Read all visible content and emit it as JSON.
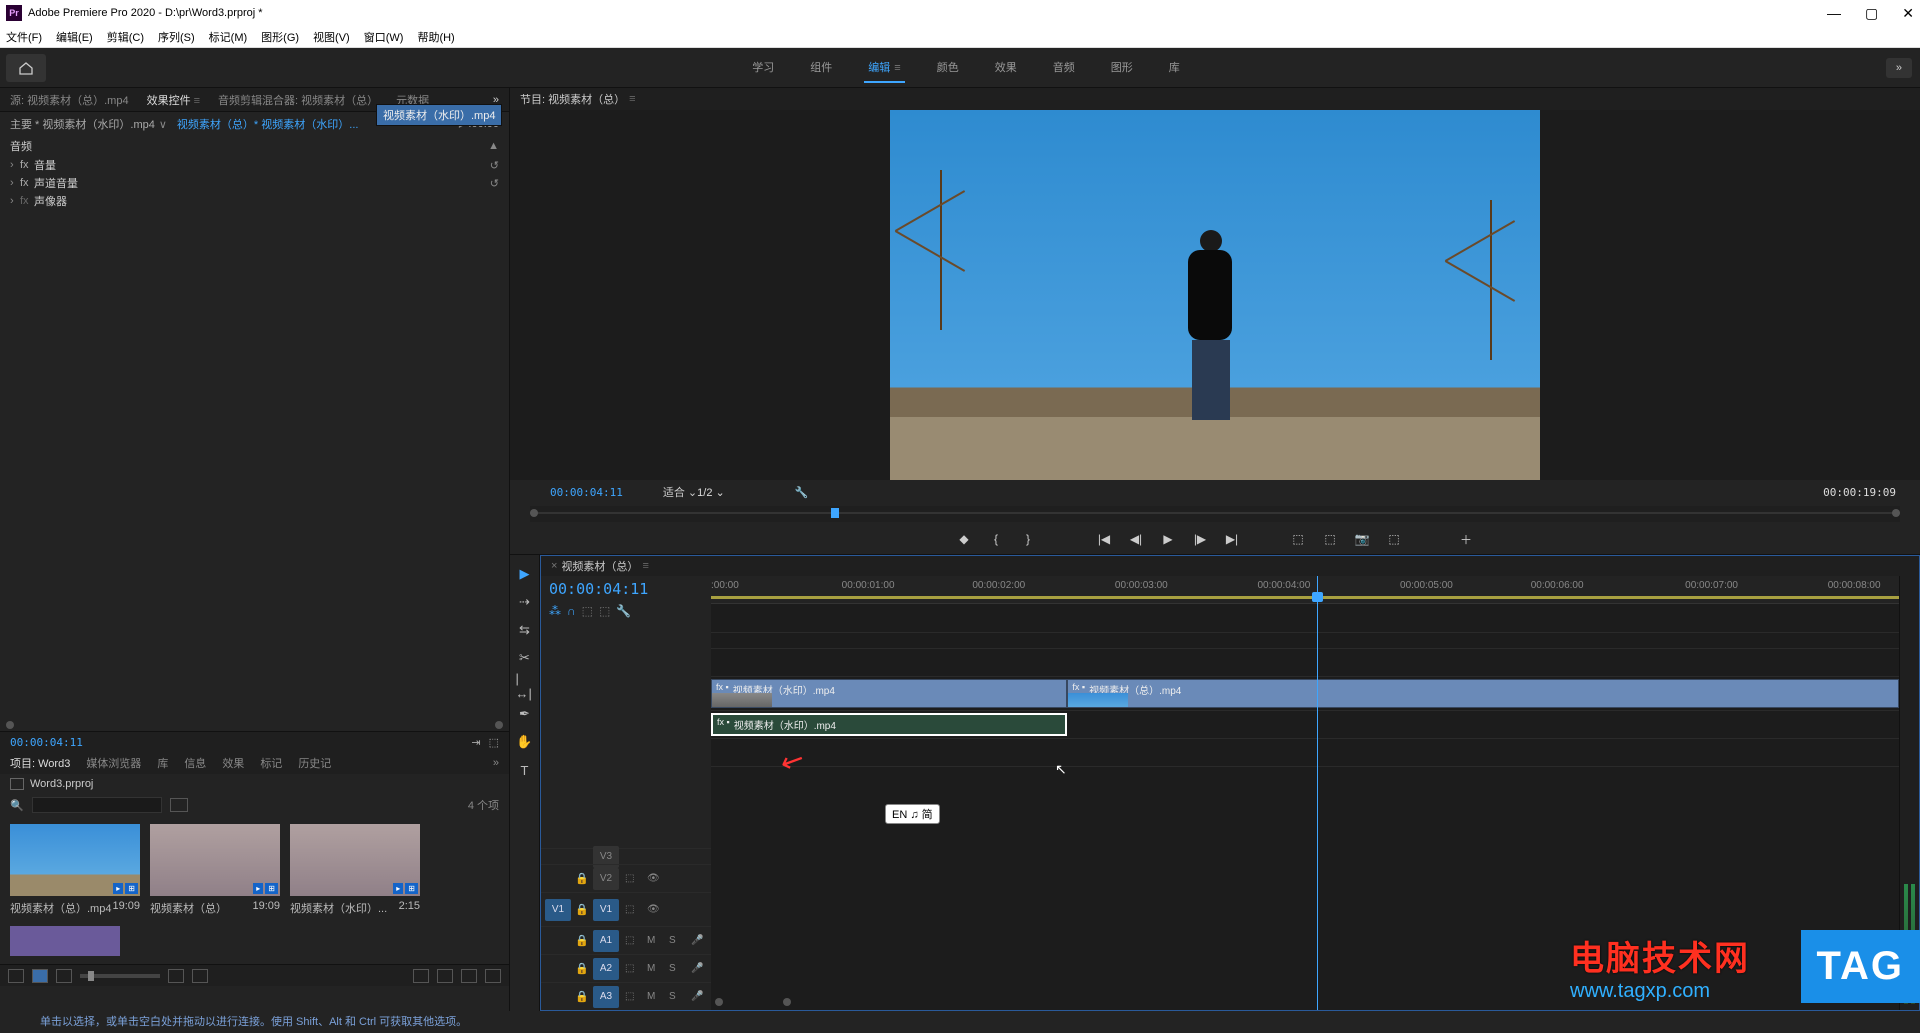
{
  "title": "Adobe Premiere Pro 2020 - D:\\pr\\Word3.prproj *",
  "menus": [
    "文件(F)",
    "编辑(E)",
    "剪辑(C)",
    "序列(S)",
    "标记(M)",
    "图形(G)",
    "视图(V)",
    "窗口(W)",
    "帮助(H)"
  ],
  "workspaces": [
    "学习",
    "组件",
    "编辑",
    "颜色",
    "效果",
    "音频",
    "图形",
    "库"
  ],
  "workspace_active": "编辑",
  "source_tabs": [
    "源: 视频素材（总）.mp4",
    "效果控件",
    "音频剪辑混合器: 视频素材（总）",
    "元数据"
  ],
  "source_active": "效果控件",
  "effect": {
    "master": "主要 * 视频素材（水印）.mp4",
    "clip": "视频素材（总）* 视频素材（水印）...",
    "time0": ":00:00",
    "token": "视频素材（水印）.mp4",
    "audio_lbl": "音频",
    "props": [
      "音量",
      "声道音量",
      "声像器"
    ]
  },
  "tc_small": "00:00:04:11",
  "project_tabs": [
    "项目: Word3",
    "媒体浏览器",
    "库",
    "信息",
    "效果",
    "标记",
    "历史记"
  ],
  "project_active": "项目: Word3",
  "project_file": "Word3.prproj",
  "search_placeholder": "",
  "item_count": "4 个项",
  "bins": [
    {
      "name": "视频素材（总）.mp4",
      "dur": "19:09",
      "cls": "sky"
    },
    {
      "name": "视频素材（总）",
      "dur": "19:09",
      "cls": "city"
    },
    {
      "name": "视频素材（水印）...",
      "dur": "2:15",
      "cls": "city"
    }
  ],
  "program": {
    "tab": "节目: 视频素材（总）",
    "tc": "00:00:04:11",
    "zoom": "适合",
    "half": "1/2",
    "total": "00:00:19:09"
  },
  "timeline": {
    "seq": "视频素材（总）",
    "tc": "00:00:04:11",
    "ticks": [
      ":00:00",
      "00:00:01:00",
      "00:00:02:00",
      "00:00:03:00",
      "00:00:04:00",
      "00:00:05:00",
      "00:00:06:00",
      "00:00:07:00",
      "00:00:08:00"
    ],
    "v": [
      "V3",
      "V2",
      "V1"
    ],
    "a": [
      "A1",
      "A2",
      "A3"
    ],
    "src_v": "V1",
    "src_a": "A1",
    "clip1": "视频素材（水印）.mp4",
    "clip2": "视频素材（总）.mp4",
    "clip3": "视频素材（水印）.mp4"
  },
  "ime": "EN ♫ 简",
  "watermark_cn": "电脑技术网",
  "watermark_url": "www.tagxp.com",
  "tag": "TAG",
  "status": "单击以选择，或单击空白处并拖动以进行连接。使用 Shift、Alt 和 Ctrl 可获取其他选项。"
}
